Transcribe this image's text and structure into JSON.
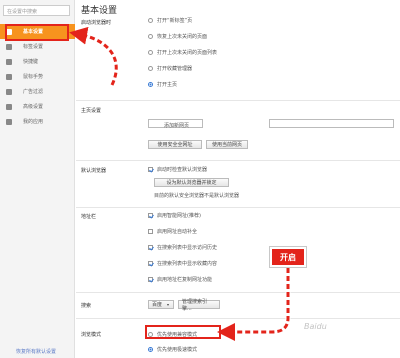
{
  "sidebar": {
    "search_placeholder": "在设置中搜索",
    "items": [
      {
        "label": "基本设置",
        "icon": "settings-icon",
        "active": true
      },
      {
        "label": "标签设置",
        "icon": "tab-icon"
      },
      {
        "label": "快捷键",
        "icon": "keyboard-icon"
      },
      {
        "label": "鼠标手势",
        "icon": "mouse-icon"
      },
      {
        "label": "广告过滤",
        "icon": "filter-icon"
      },
      {
        "label": "高级设置",
        "icon": "wrench-icon"
      },
      {
        "label": "我的应用",
        "icon": "apps-icon"
      }
    ],
    "restore_link": "恢复所有默认设置"
  },
  "main": {
    "title": "基本设置",
    "startup": {
      "label": "启动浏览器时",
      "options": [
        "打开“新标签”页",
        "恢复上次未关闭的页面",
        "打开上次未关闭的页面列表",
        "打开收藏管理器",
        "打开主页"
      ],
      "selected_index": 4
    },
    "homepage": {
      "label": "主页设置",
      "add_link": "添加新网页",
      "btn_safe": "使用安全全网址",
      "btn_current": "使用当前网页"
    },
    "default_browser": {
      "label": "默认浏览器",
      "check_label": "启动时检查默认浏览器",
      "btn_set": "设为默认浏览器并锁定",
      "note": "目前的默认安全浏览器不是默认浏览器"
    },
    "address_bar": {
      "label": "地址栏",
      "options": [
        {
          "label": "启用智能网址(推荐)",
          "checked": true
        },
        {
          "label": "启用网址自动补全",
          "checked": false
        },
        {
          "label": "在搜索列表中显示访问历史",
          "checked": true
        },
        {
          "label": "在搜索列表中显示收藏内容",
          "checked": true
        },
        {
          "label": "启用地址栏复制网址功能",
          "checked": true
        }
      ]
    },
    "search": {
      "label": "搜索",
      "engine": "百度",
      "btn_manage": "管理搜索引擎..."
    },
    "browse_mode": {
      "label": "浏览模式",
      "options": [
        "优先使用兼容模式",
        "优先使用极速模式"
      ],
      "selected_index": 1
    }
  },
  "annotation": {
    "callout_text": "开启",
    "accent_color": "#e3241b"
  },
  "watermark": "Baidu"
}
